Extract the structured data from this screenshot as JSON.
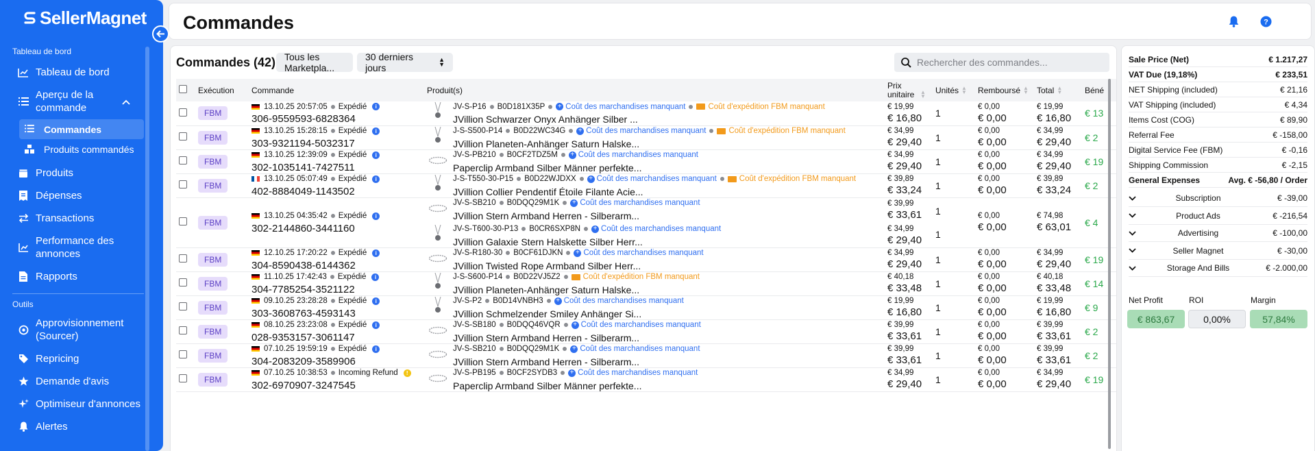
{
  "brand": {
    "name": "SellerMagnet"
  },
  "sidebar": {
    "section_dashboard": "Tableau de bord",
    "items_top": [
      {
        "label": "Tableau de bord",
        "icon": "chart-line-icon"
      },
      {
        "label": "Aperçu de la commande",
        "icon": "list-icon"
      }
    ],
    "sub_items": [
      {
        "label": "Commandes",
        "icon": "list-icon"
      },
      {
        "label": "Produits commandés",
        "icon": "boxes-icon"
      }
    ],
    "items_mid": [
      {
        "label": "Produits",
        "icon": "box-icon"
      },
      {
        "label": "Dépenses",
        "icon": "receipt-icon"
      },
      {
        "label": "Transactions",
        "icon": "transfer-icon"
      },
      {
        "label": "Performance des annonces",
        "icon": "chart-bar-icon"
      },
      {
        "label": "Rapports",
        "icon": "file-icon"
      }
    ],
    "section_tools": "Outils",
    "items_tools": [
      {
        "label": "Approvisionnement (Sourcer)",
        "icon": "sourcer-icon"
      },
      {
        "label": "Repricing",
        "icon": "tag-icon"
      },
      {
        "label": "Demande d'avis",
        "icon": "star-icon"
      },
      {
        "label": "Optimiseur d'annonces",
        "icon": "sparkle-icon"
      },
      {
        "label": "Alertes",
        "icon": "bell-icon"
      }
    ]
  },
  "header": {
    "title": "Commandes"
  },
  "orders_panel": {
    "title": "Commandes (42)",
    "marketplace_filter": "Tous les Marketpla...",
    "period_filter": "30 derniers jours",
    "search_placeholder": "Rechercher des commandes...",
    "columns": [
      "Exécution",
      "Commande",
      "Produit(s)",
      "Prix unitaire",
      "Unités",
      "Remboursé",
      "Total",
      "Béné"
    ],
    "rows": [
      {
        "fulfillment": "FBM",
        "flag": "de",
        "date": "13.10.25 20:57:05",
        "status": "Expédié",
        "order_id": "306-9559593-6828364",
        "products": [
          {
            "sku": "JV-S-P16",
            "asin": "B0D181X35P",
            "missing_cost": "Coût des marchandises manquant",
            "missing_ship": "Coût d'expédition FBM manquant",
            "title": "JVillion Schwarzer Onyx Anhänger Silber ...",
            "price_gross": "€ 19,99",
            "price_net": "€ 16,80",
            "units": "1"
          }
        ],
        "refund": "€ 0,00",
        "refund_net": "€ 0,00",
        "total": "€ 19,99",
        "total_net": "€ 16,80",
        "profit": "€ 13"
      },
      {
        "fulfillment": "FBM",
        "flag": "de",
        "date": "13.10.25 15:28:15",
        "status": "Expédié",
        "order_id": "303-9321194-5032317",
        "products": [
          {
            "sku": "J-S-S500-P14",
            "asin": "B0D22WC34G",
            "missing_cost": "Coût des marchandises manquant",
            "missing_ship": "Coût d'expédition FBM manquant",
            "title": "JVillion Planeten-Anhänger Saturn Halske...",
            "price_gross": "€ 34,99",
            "price_net": "€ 29,40",
            "units": "1"
          }
        ],
        "refund": "€ 0,00",
        "refund_net": "€ 0,00",
        "total": "€ 34,99",
        "total_net": "€ 29,40",
        "profit": "€ 2"
      },
      {
        "fulfillment": "FBM",
        "flag": "de",
        "date": "13.10.25 12:39:09",
        "status": "Expédié",
        "order_id": "302-1035141-7427511",
        "products": [
          {
            "sku": "JV-S-PB210",
            "asin": "B0CF2TDZ5M",
            "missing_cost": "Coût des marchandises manquant",
            "missing_ship": "",
            "title": "Paperclip Armband Silber Männer perfekte...",
            "price_gross": "€ 34,99",
            "price_net": "€ 29,40",
            "units": "1"
          }
        ],
        "refund": "€ 0,00",
        "refund_net": "€ 0,00",
        "total": "€ 34,99",
        "total_net": "€ 29,40",
        "profit": "€ 19"
      },
      {
        "fulfillment": "FBM",
        "flag": "fr",
        "date": "13.10.25 05:07:49",
        "status": "Expédié",
        "order_id": "402-8884049-1143502",
        "products": [
          {
            "sku": "J-S-T550-30-P15",
            "asin": "B0D22WJDXX",
            "missing_cost": "Coût des marchandises manquant",
            "missing_ship": "Coût d'expédition FBM manquant",
            "title": "JVillion Collier Pendentif Étoile Filante Acie...",
            "price_gross": "€ 39,89",
            "price_net": "€ 33,24",
            "units": "1"
          }
        ],
        "refund": "€ 0,00",
        "refund_net": "€ 0,00",
        "total": "€ 39,89",
        "total_net": "€ 33,24",
        "profit": "€ 2"
      },
      {
        "fulfillment": "FBM",
        "flag": "de",
        "date": "13.10.25 04:35:42",
        "status": "Expédié",
        "order_id": "302-2144860-3441160",
        "products": [
          {
            "sku": "JV-S-SB210",
            "asin": "B0DQQ29M1K",
            "missing_cost": "Coût des marchandises manquant",
            "missing_ship": "",
            "title": "JVillion Stern Armband Herren - Silberarm...",
            "price_gross": "€ 39,99",
            "price_net": "€ 33,61",
            "units": "1"
          },
          {
            "sku": "JV-S-T600-30-P13",
            "asin": "B0CR6SXP8N",
            "missing_cost": "Coût des marchandises manquant",
            "missing_ship": "",
            "title": "JVillion Galaxie Stern Halskette Silber Herr...",
            "price_gross": "€ 34,99",
            "price_net": "€ 29,40",
            "units": "1"
          }
        ],
        "refund": "€ 0,00",
        "refund_net": "€ 0,00",
        "total": "€ 74,98",
        "total_net": "€ 63,01",
        "profit": "€ 4"
      },
      {
        "fulfillment": "FBM",
        "flag": "de",
        "date": "12.10.25 17:20:22",
        "status": "Expédié",
        "order_id": "304-8590438-6144362",
        "products": [
          {
            "sku": "JV-S-R180-30",
            "asin": "B0CF61DJKN",
            "missing_cost": "Coût des marchandises manquant",
            "missing_ship": "",
            "title": "JVillion Twisted Rope Armband Silber Herr...",
            "price_gross": "€ 34,99",
            "price_net": "€ 29,40",
            "units": "1"
          }
        ],
        "refund": "€ 0,00",
        "refund_net": "€ 0,00",
        "total": "€ 34,99",
        "total_net": "€ 29,40",
        "profit": "€ 19"
      },
      {
        "fulfillment": "FBM",
        "flag": "de",
        "date": "11.10.25 17:42:43",
        "status": "Expédié",
        "order_id": "304-7785254-3521122",
        "products": [
          {
            "sku": "J-S-S600-P14",
            "asin": "B0D22VJ5Z2",
            "missing_cost": "",
            "missing_ship": "Coût d'expédition FBM manquant",
            "title": "JVillion Planeten-Anhänger Saturn Halske...",
            "price_gross": "€ 40,18",
            "price_net": "€ 33,48",
            "units": "1"
          }
        ],
        "refund": "€ 0,00",
        "refund_net": "€ 0,00",
        "total": "€ 40,18",
        "total_net": "€ 33,48",
        "profit": "€ 14"
      },
      {
        "fulfillment": "FBM",
        "flag": "de",
        "date": "09.10.25 23:28:28",
        "status": "Expédié",
        "order_id": "303-3608763-4593143",
        "products": [
          {
            "sku": "JV-S-P2",
            "asin": "B0D14VNBH3",
            "missing_cost": "Coût des marchandises manquant",
            "missing_ship": "",
            "title": "JVillion Schmelzender Smiley Anhänger Si...",
            "price_gross": "€ 19,99",
            "price_net": "€ 16,80",
            "units": "1"
          }
        ],
        "refund": "€ 0,00",
        "refund_net": "€ 0,00",
        "total": "€ 19,99",
        "total_net": "€ 16,80",
        "profit": "€ 9"
      },
      {
        "fulfillment": "FBM",
        "flag": "de",
        "date": "08.10.25 23:23:08",
        "status": "Expédié",
        "order_id": "028-9353157-3061147",
        "products": [
          {
            "sku": "JV-S-SB180",
            "asin": "B0DQQ46VQR",
            "missing_cost": "Coût des marchandises manquant",
            "missing_ship": "",
            "title": "JVillion Stern Armband Herren - Silberarm...",
            "price_gross": "€ 39,99",
            "price_net": "€ 33,61",
            "units": "1"
          }
        ],
        "refund": "€ 0,00",
        "refund_net": "€ 0,00",
        "total": "€ 39,99",
        "total_net": "€ 33,61",
        "profit": "€ 2"
      },
      {
        "fulfillment": "FBM",
        "flag": "de",
        "date": "07.10.25 19:59:19",
        "status": "Expédié",
        "order_id": "304-2083209-3589906",
        "products": [
          {
            "sku": "JV-S-SB210",
            "asin": "B0DQQ29M1K",
            "missing_cost": "Coût des marchandises manquant",
            "missing_ship": "",
            "title": "JVillion Stern Armband Herren - Silberarm...",
            "price_gross": "€ 39,99",
            "price_net": "€ 33,61",
            "units": "1"
          }
        ],
        "refund": "€ 0,00",
        "refund_net": "€ 0,00",
        "total": "€ 39,99",
        "total_net": "€ 33,61",
        "profit": "€ 2"
      },
      {
        "fulfillment": "FBM",
        "flag": "de",
        "date": "07.10.25 10:38:53",
        "status": "Incoming Refund",
        "order_id": "302-6970907-3247545",
        "products": [
          {
            "sku": "JV-S-PB195",
            "asin": "B0CF2SYDB3",
            "missing_cost": "Coût des marchandises manquant",
            "missing_ship": "",
            "title": "Paperclip Armband Silber Männer perfekte...",
            "price_gross": "€ 34,99",
            "price_net": "€ 29,40",
            "units": "1"
          }
        ],
        "refund": "€ 0,00",
        "refund_net": "€ 0,00",
        "total": "€ 34,99",
        "total_net": "€ 29,40",
        "profit": "€ 19"
      }
    ]
  },
  "summary": {
    "rows": [
      {
        "label": "Sale Price (Net)",
        "value": "€ 1.217,27",
        "bold": true
      },
      {
        "label": "VAT Due (19,18%)",
        "value": "€ 233,51",
        "bold": true
      },
      {
        "label": "NET Shipping (included)",
        "value": "€ 21,16",
        "bold": false
      },
      {
        "label": "VAT Shipping (included)",
        "value": "€ 4,34",
        "bold": false
      },
      {
        "label": "Items Cost (COG)",
        "value": "€ 89,90",
        "bold": false
      },
      {
        "label": "Referral Fee",
        "value": "€ -158,00",
        "bold": false
      },
      {
        "label": "Digital Service Fee (FBM)",
        "value": "€ -0,16",
        "bold": false
      },
      {
        "label": "Shipping Commission",
        "value": "€ -2,15",
        "bold": false
      },
      {
        "label": "General Expenses",
        "value": "Avg. € -56,80 / Order",
        "bold": true
      }
    ],
    "expenses": [
      {
        "label": "Subscription",
        "value": "€ -39,00"
      },
      {
        "label": "Product Ads",
        "value": "€ -216,54"
      },
      {
        "label": "Advertising",
        "value": "€ -100,00"
      },
      {
        "label": "Seller Magnet",
        "value": "€ -30,00"
      },
      {
        "label": "Storage And Bills",
        "value": "€ -2.000,00"
      }
    ],
    "net_profit_label": "Net Profit",
    "net_profit": "€ 863,67",
    "roi_label": "ROI",
    "roi": "0,00%",
    "margin_label": "Margin",
    "margin": "57,84%"
  },
  "colors": {
    "brand": "#1a6cf0",
    "missing_cost": "#2f6ff0",
    "missing_ship": "#f29a1b",
    "profit": "#2aa84a",
    "fbm_badge": "#e6dcfb"
  }
}
